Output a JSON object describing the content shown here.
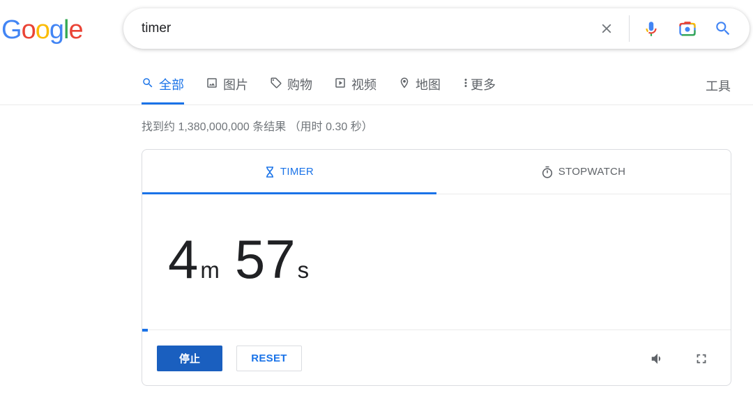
{
  "logo": {
    "text": "Google",
    "colors": [
      "#4285F4",
      "#EA4335",
      "#FBBC05",
      "#4285F4",
      "#34A853",
      "#EA4335"
    ]
  },
  "search": {
    "value": "timer"
  },
  "tabs": [
    {
      "label": "全部",
      "icon": "search-icon",
      "active": true
    },
    {
      "label": "图片",
      "icon": "image-icon"
    },
    {
      "label": "购物",
      "icon": "tag-icon"
    },
    {
      "label": "视频",
      "icon": "play-icon"
    },
    {
      "label": "地图",
      "icon": "map-pin-icon"
    },
    {
      "label": "更多",
      "icon": "more-vert-icon"
    }
  ],
  "tools_label": "工具",
  "stats": "找到约 1,380,000,000 条结果 （用时 0.30 秒）",
  "timer": {
    "tabs": {
      "timer": "TIMER",
      "stopwatch": "STOPWATCH"
    },
    "minutes": "4",
    "minutes_unit": "m",
    "seconds": "57",
    "seconds_unit": "s",
    "progress": 0.01,
    "stop_label": "停止",
    "reset_label": "RESET"
  },
  "colors": {
    "accent": "#1a73e8",
    "stop_button": "#1a5fbf"
  }
}
